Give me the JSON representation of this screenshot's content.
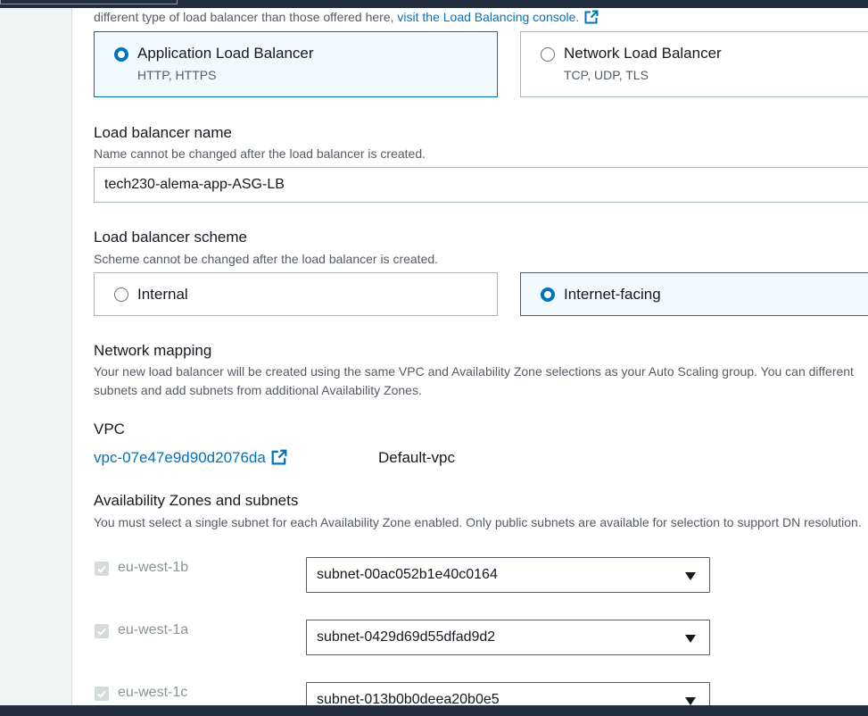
{
  "intro": {
    "text": "different type of load balancer than those offered here,",
    "link": "visit the Load Balancing console."
  },
  "lb_type": {
    "options": [
      {
        "title": "Application Load Balancer",
        "desc": "HTTP, HTTPS",
        "selected": true
      },
      {
        "title": "Network Load Balancer",
        "desc": "TCP, UDP, TLS",
        "selected": false
      }
    ]
  },
  "lb_name": {
    "label": "Load balancer name",
    "desc": "Name cannot be changed after the load balancer is created.",
    "value": "tech230-alema-app-ASG-LB"
  },
  "scheme": {
    "label": "Load balancer scheme",
    "desc": "Scheme cannot be changed after the load balancer is created.",
    "options": [
      {
        "title": "Internal",
        "selected": false
      },
      {
        "title": "Internet-facing",
        "selected": true
      }
    ]
  },
  "network": {
    "label": "Network mapping",
    "desc": "Your new load balancer will be created using the same VPC and Availability Zone selections as your Auto Scaling group. You can different subnets and add subnets from additional Availability Zones."
  },
  "vpc": {
    "label": "VPC",
    "id": "vpc-07e47e9d90d2076da",
    "name": "Default-vpc"
  },
  "az": {
    "label": "Availability Zones and subnets",
    "desc": "You must select a single subnet for each Availability Zone enabled. Only public subnets are available for selection to support DN resolution.",
    "zones": [
      {
        "zone": "eu-west-1b",
        "subnet": "subnet-00ac052b1e40c0164",
        "checked": true
      },
      {
        "zone": "eu-west-1a",
        "subnet": "subnet-0429d69d55dfad9d2",
        "checked": true
      },
      {
        "zone": "eu-west-1c",
        "subnet": "subnet-013b0b0deea20b0e5",
        "checked": true
      }
    ]
  },
  "colors": {
    "accent": "#0073bb",
    "selected_bg": "#f1faff",
    "header_bg": "#232f3e"
  }
}
